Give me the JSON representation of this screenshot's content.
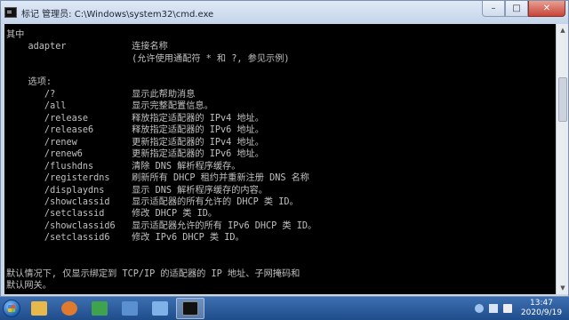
{
  "window": {
    "title": "标记 管理员: C:\\Windows\\system32\\cmd.exe",
    "minimize_glyph": "–",
    "maximize_glyph": "□",
    "close_glyph": "✕"
  },
  "console": {
    "lines": [
      "其中",
      "    adapter            连接名称",
      "                       (允许使用通配符 * 和 ?, 参见示例)",
      "",
      "    选项:",
      "       /?              显示此帮助消息",
      "       /all            显示完整配置信息。",
      "       /release        释放指定适配器的 IPv4 地址。",
      "       /release6       释放指定适配器的 IPv6 地址。",
      "       /renew          更新指定适配器的 IPv4 地址。",
      "       /renew6         更新指定适配器的 IPv6 地址。",
      "       /flushdns       清除 DNS 解析程序缓存。",
      "       /registerdns    刷新所有 DHCP 租约并重新注册 DNS 名称",
      "       /displaydns     显示 DNS 解析程序缓存的内容。",
      "       /showclassid    显示适配器的所有允许的 DHCP 类 ID。",
      "       /setclassid     修改 DHCP 类 ID。",
      "       /showclassid6   显示适配器允许的所有 IPv6 DHCP 类 ID。",
      "       /setclassid6    修改 IPv6 DHCP 类 ID。",
      "",
      "",
      "默认情况下, 仅显示绑定到 TCP/IP 的适配器的 IP 地址、子网掩码和",
      "默认网关。"
    ]
  },
  "taskbar": {
    "apps": [
      {
        "name": "file-explorer",
        "color": "#e8b84a"
      },
      {
        "name": "media-player",
        "color": "#e07a2e"
      },
      {
        "name": "browser",
        "color": "#3fa34d"
      },
      {
        "name": "network-tool",
        "color": "#5a8fd0"
      },
      {
        "name": "control-panel",
        "color": "#7fb3e8"
      },
      {
        "name": "command-prompt",
        "color": "#111111"
      }
    ],
    "time": "13:47",
    "date": "2020/9/19"
  }
}
